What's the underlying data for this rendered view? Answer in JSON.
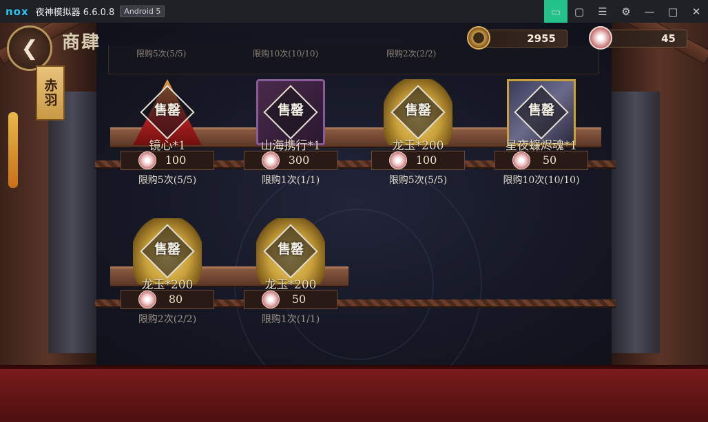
{
  "titlebar": {
    "logo": "nox",
    "title": "夜神模拟器 6.6.0.8",
    "badge": "Android 5",
    "buttons": [
      "bag-icon",
      "shirt-icon",
      "menu-icon",
      "settings-icon",
      "minimize-icon",
      "maximize-icon",
      "close-icon"
    ]
  },
  "header": {
    "title": "商肆",
    "tag": "赤羽",
    "back_icon": "back-arrow-icon"
  },
  "currencies": [
    {
      "name": "gold-coin",
      "value": "2955"
    },
    {
      "name": "jade",
      "value": "45"
    }
  ],
  "top_panel": {
    "limits": [
      "限购5次(5/5)",
      "限购10次(10/10)",
      "限购2次(2/2)"
    ]
  },
  "shop": {
    "rows": [
      [
        {
          "name": "镜心*1",
          "price": "100",
          "limit": "限购5次(5/5)",
          "sold": "售罄",
          "art": "mirror"
        },
        {
          "name": "山海携行*1",
          "price": "300",
          "limit": "限购1次(1/1)",
          "sold": "售罄",
          "art": "shanhai"
        },
        {
          "name": "龙玉*200",
          "price": "100",
          "limit": "限购5次(5/5)",
          "sold": "售罄",
          "art": "dragon"
        },
        {
          "name": "星夜蠊烬魂*1",
          "price": "50",
          "limit": "限购10次(10/10)",
          "sold": "售罄",
          "art": "star"
        }
      ],
      [
        {
          "name": "龙玉*200",
          "price": "80",
          "limit": "限购2次(2/2)",
          "sold": "售罄",
          "art": "dragon"
        },
        {
          "name": "龙玉*200",
          "price": "50",
          "limit": "限购1次(1/1)",
          "sold": "售罄",
          "art": "dragon"
        }
      ]
    ]
  },
  "colors": {
    "accent": "#25c38c",
    "title_text": "#d9cdb3",
    "stage_red": "#7a1c1c"
  }
}
